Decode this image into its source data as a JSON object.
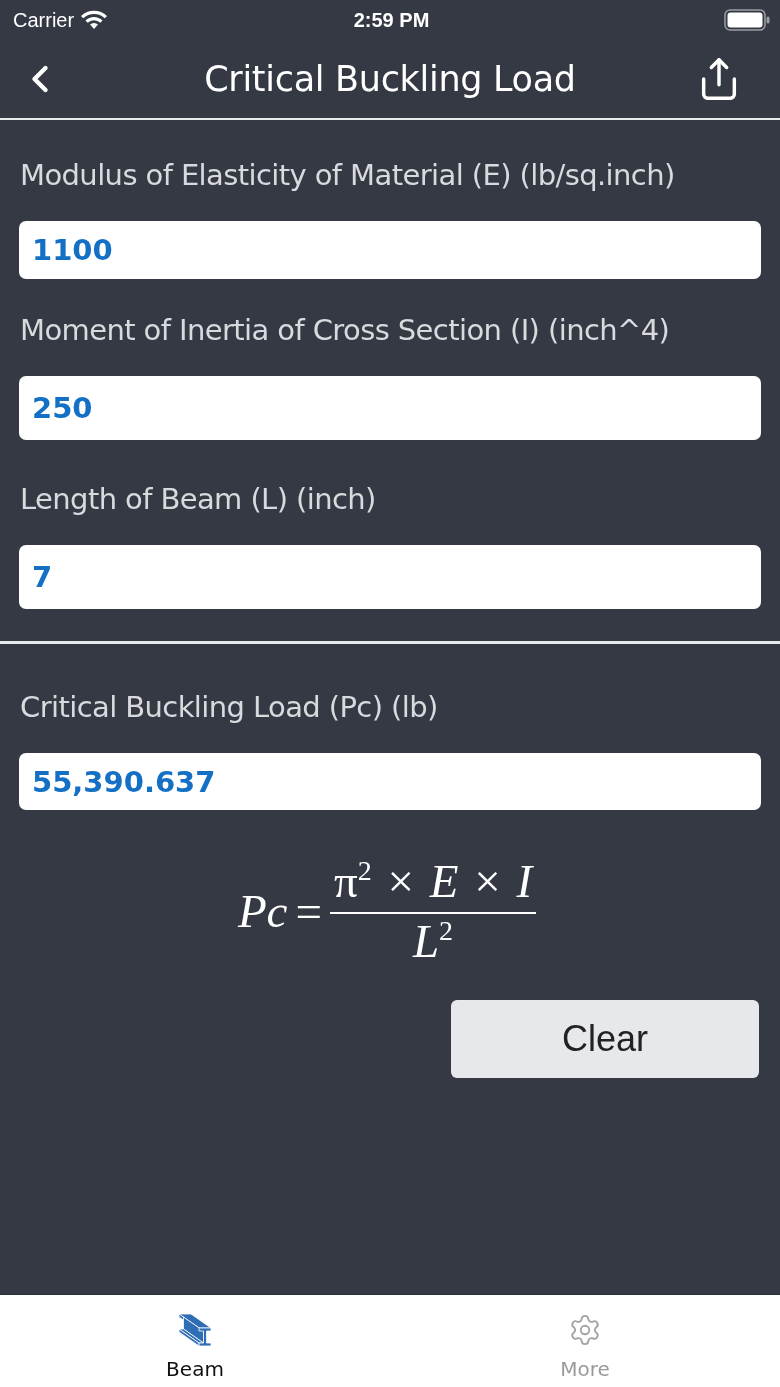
{
  "status_bar": {
    "carrier": "Carrier",
    "time": "2:59 PM"
  },
  "nav_bar": {
    "title": "Critical Buckling Load"
  },
  "inputs": [
    {
      "label": "Modulus of Elasticity of Material (E) (lb/sq.inch)",
      "value": "1100"
    },
    {
      "label": "Moment of Inertia of Cross Section (I) (inch^4)",
      "value": "250"
    },
    {
      "label": "Length of Beam (L) (inch)",
      "value": "7"
    }
  ],
  "result": {
    "label": "Critical Buckling Load (Pc) (lb)",
    "value": "55,390.637"
  },
  "formula": {
    "lhs": "Pc",
    "equals": "=",
    "numerator": "π$^{2}$ × *E* × *I*",
    "denominator": "*L*$^{2}$"
  },
  "clear_button": {
    "label": "Clear"
  },
  "tab_bar": [
    {
      "label": "Beam",
      "kind": "beam",
      "selected": true
    },
    {
      "label": "More",
      "kind": "gear",
      "selected": false
    }
  ]
}
